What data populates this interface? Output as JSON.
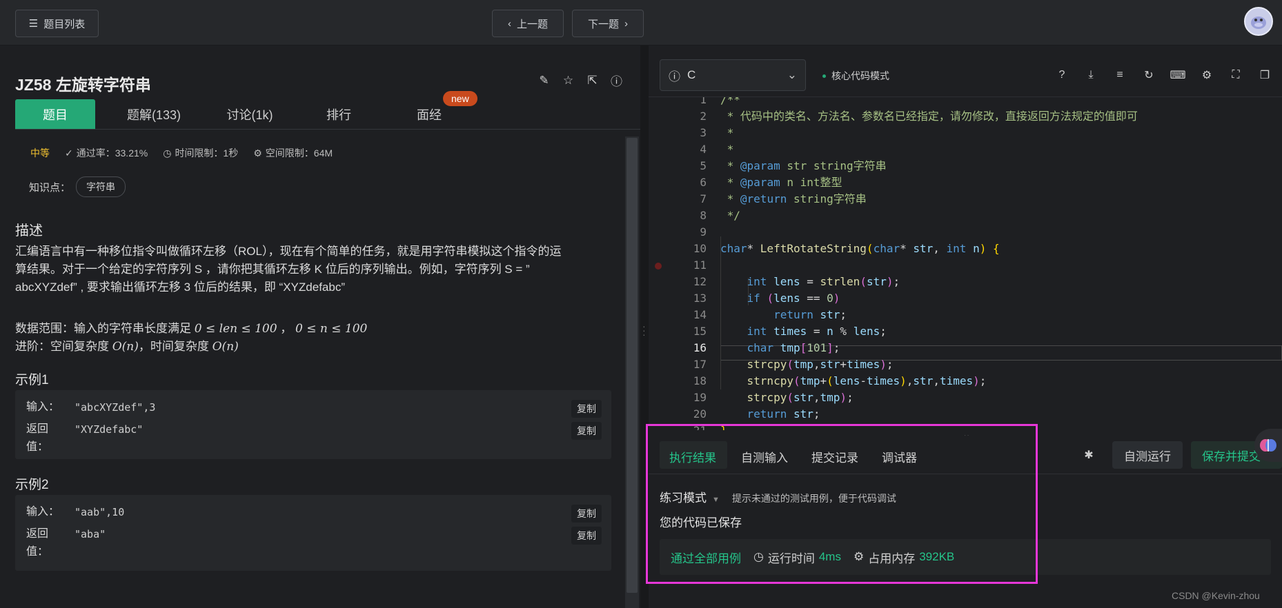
{
  "topbar": {
    "problem_list": "题目列表",
    "prev": "上一题",
    "next": "下一题"
  },
  "problem": {
    "title": "JZ58  左旋转字符串",
    "tabs": [
      "题目",
      "题解(133)",
      "讨论(1k)",
      "排行",
      "面经"
    ],
    "new_badge": "new",
    "difficulty": "中等",
    "pass_rate": "通过率：33.21%",
    "time_limit": "时间限制：1秒",
    "space_limit": "空间限制：64M",
    "knowledge_label": "知识点：",
    "knowledge_tag": "字符串",
    "desc_heading": "描述",
    "desc_line1": "汇编语言中有一种移位指令叫做循环左移（ROL），现在有个简单的任务，就是用字符串模拟这个指令的运",
    "desc_line2": "算结果。对于一个给定的字符序列  S ，请你把其循环左移 K 位后的序列输出。例如，字符序列 S = ”",
    "desc_line3": "abcXYZdef” , 要求输出循环左移 3 位后的结果，即 “XYZdefabc”",
    "range_label": "数据范围：输入的字符串长度满足 ",
    "range_math1": "0 ≤ len ≤ 100",
    "range_sep": " ， ",
    "range_math2": "0 ≤ n ≤ 100",
    "advance_label": "进阶：空间复杂度 ",
    "advance_math1": "O(n)",
    "advance_mid": "，时间复杂度 ",
    "advance_math2": "O(n)",
    "ex1_heading": "示例1",
    "ex1_in_label": "输入：",
    "ex1_in": "\"abcXYZdef\",3",
    "ex1_out_label1": "返回",
    "ex1_out_label2": "值：",
    "ex1_out": "\"XYZdefabc\"",
    "ex2_heading": "示例2",
    "ex2_in_label": "输入：",
    "ex2_in": "\"aab\",10",
    "ex2_out_label1": "返回",
    "ex2_out_label2": "值：",
    "ex2_out": "\"aba\"",
    "copy": "复制"
  },
  "editor": {
    "language": "C",
    "mode": "核心代码模式",
    "current_line": 16,
    "breakpoint_line": 11
  },
  "result": {
    "tabs": [
      "执行结果",
      "自测输入",
      "提交记录",
      "调试器"
    ],
    "self_run": "自测运行",
    "submit": "保存并提交",
    "practice_mode": "练习模式",
    "practice_hint": "提示未通过的测试用例，便于代码调试",
    "saved": "您的代码已保存",
    "pass_all": "通过全部用例",
    "runtime_label": "运行时间",
    "runtime_value": "4ms",
    "memory_label": "占用内存",
    "memory_value": "392KB"
  },
  "watermark": "CSDN @Kevin-zhou",
  "colors": {
    "accent": "#25a876",
    "success_text": "#25c48a",
    "highlight_box": "#e637d8",
    "difficulty": "#f2c230",
    "new_badge": "#c94a1d"
  }
}
